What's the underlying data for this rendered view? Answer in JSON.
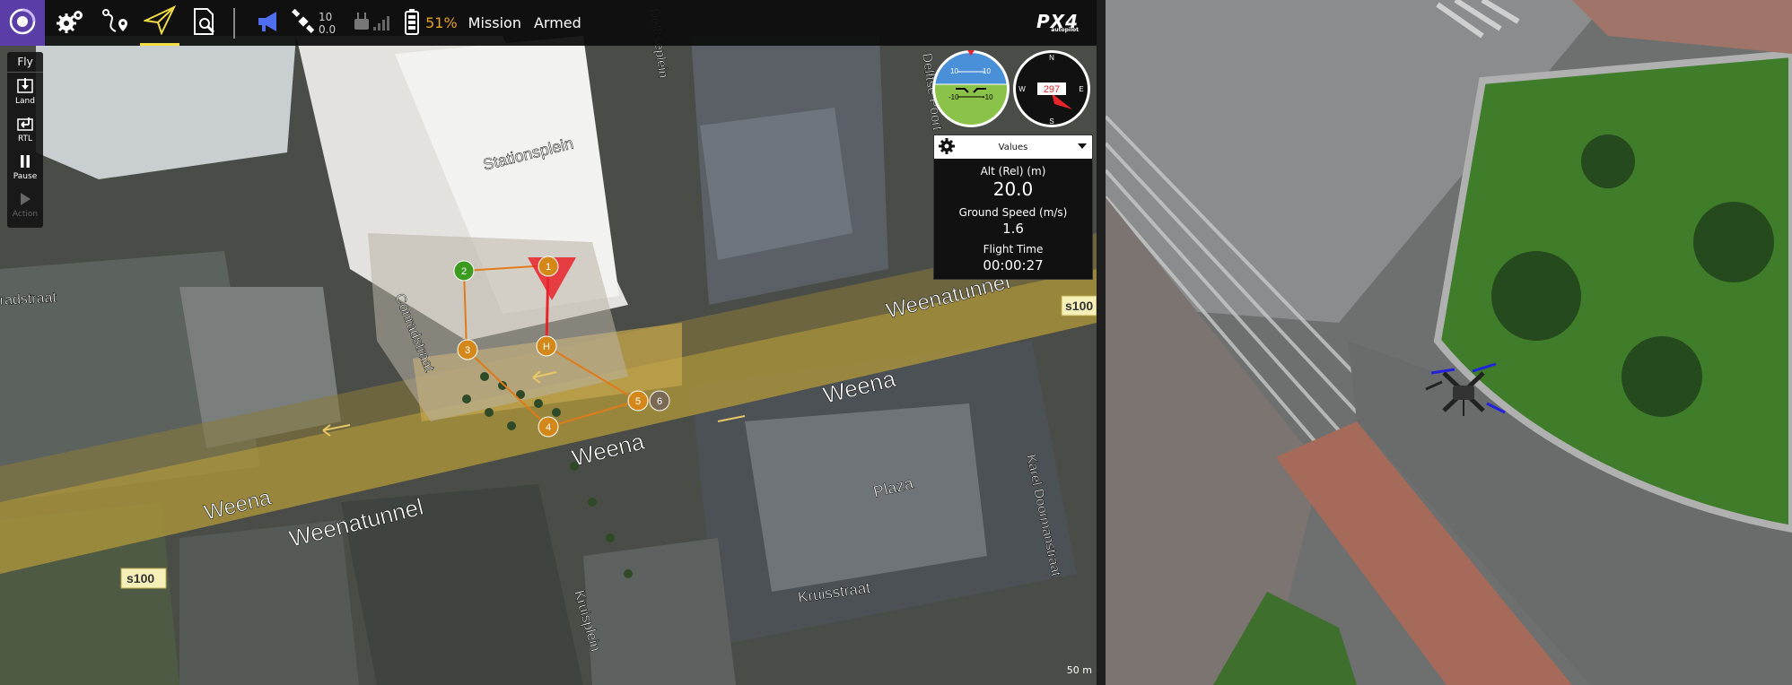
{
  "toolbar": {
    "buttons": [
      {
        "name": "qgc-logo",
        "icon": "logo-icon"
      },
      {
        "name": "settings",
        "icon": "gear-icon"
      },
      {
        "name": "plan",
        "icon": "route-plan-icon"
      },
      {
        "name": "fly",
        "icon": "paper-plane-icon",
        "active": true
      },
      {
        "name": "analyze",
        "icon": "document-search-icon"
      }
    ],
    "satellite_count": "10",
    "hdop": "0.0",
    "battery_percent": "51%",
    "flight_mode": "Mission",
    "arm_state": "Armed",
    "brand": "PX4",
    "brand_sub": "autopilot"
  },
  "fly_tools": {
    "title": "Fly",
    "items": [
      {
        "label": "Land",
        "icon": "land-icon",
        "enabled": true
      },
      {
        "label": "RTL",
        "icon": "rtl-icon",
        "enabled": true
      },
      {
        "label": "Pause",
        "icon": "pause-icon",
        "enabled": true
      },
      {
        "label": "Action",
        "icon": "play-icon",
        "enabled": false
      }
    ]
  },
  "attitude": {
    "pitch_ticks": [
      "10",
      "-10"
    ]
  },
  "compass": {
    "heading": "297",
    "cardinals": [
      "N",
      "E",
      "S",
      "W"
    ]
  },
  "values_panel": {
    "header": "Values",
    "alt_label": "Alt (Rel) (m)",
    "alt_value": "20.0",
    "speed_label": "Ground Speed (m/s)",
    "speed_value": "1.6",
    "time_label": "Flight Time",
    "time_value": "00:00:27"
  },
  "mission": {
    "waypoints": [
      "1",
      "2",
      "3",
      "4",
      "5",
      "6"
    ],
    "home": "H",
    "colors": {
      "current": "#3a9b1e",
      "waypoint": "#d4881a",
      "path": "#e07a1a",
      "vehicle": "#e8232a"
    }
  },
  "map_labels": {
    "street1": "Stationsplein",
    "street2": "Conradstraat",
    "street3": "Delftseplein",
    "street4": "Delftse Poort",
    "street5": "Weenatunnel",
    "street6": "Weena",
    "street7": "Weena",
    "street8": "Weena",
    "street9": "Weenatunnel",
    "street10": "Kruisplein",
    "street11": "Kruisstraat",
    "street12": "Karel Doormanstraat",
    "street13": "Plaza",
    "street14": "radstraat",
    "shield1": "s100",
    "shield2": "s100",
    "scale": "50 m"
  }
}
